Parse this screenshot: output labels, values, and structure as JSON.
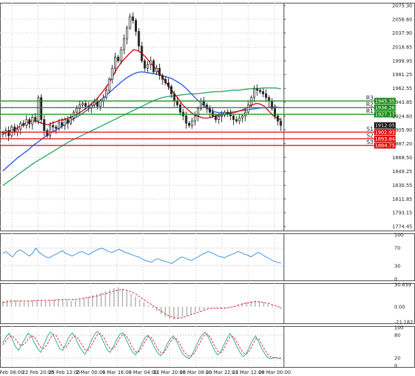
{
  "chart_data": {
    "type": "candlestick",
    "main": {
      "price_ticks": [
        "2075.30",
        "2056.60",
        "2037.90",
        "2018.65",
        "1999.95",
        "1981.25",
        "1962.55",
        "1943.85",
        "1924.60",
        "1905.90",
        "1887.20",
        "1868.50",
        "1849.25",
        "1830.55",
        "1811.85",
        "1793.15",
        "1774.45"
      ],
      "ylim": [
        1774.45,
        2075.3
      ],
      "current_price": "1912.05",
      "levels": [
        {
          "label": "R3",
          "value": 1945.35,
          "tag": "1945.35",
          "color": "#1a8c1a"
        },
        {
          "label": "R2",
          "value": 1936.26,
          "tag": "1936.26",
          "color": "#1a8c1a"
        },
        {
          "label": "R1",
          "value": 1927.17,
          "tag": "1927.17",
          "color": "#1a8c1a"
        },
        {
          "label": "S1",
          "value": 1902.93,
          "tag": "1902.93",
          "color": "#e01010"
        },
        {
          "label": "S2",
          "value": 1893.84,
          "tag": "1893.84",
          "color": "#e01010"
        },
        {
          "label": "S3",
          "value": 1884.75,
          "tag": "1884.75",
          "color": "#e01010"
        }
      ],
      "close_series": [
        1902,
        1905,
        1898,
        1910,
        1903,
        1907,
        1915,
        1912,
        1920,
        1914,
        1923,
        1918,
        1950,
        1920,
        1905,
        1898,
        1912,
        1910,
        1908,
        1916,
        1912,
        1920,
        1915,
        1922,
        1930,
        1935,
        1940,
        1942,
        1938,
        1936,
        1940,
        1944,
        1938,
        1945,
        1950,
        1960,
        1975,
        1990,
        2005,
        2000,
        2015,
        2030,
        2045,
        2060,
        2055,
        2040,
        2020,
        2000,
        1990,
        1995,
        2000,
        1985,
        1990,
        1980,
        1975,
        1970,
        1965,
        1955,
        1945,
        1940,
        1930,
        1925,
        1915,
        1912,
        1918,
        1925,
        1935,
        1945,
        1940,
        1935,
        1930,
        1925,
        1920,
        1924,
        1926,
        1930,
        1928,
        1925,
        1920,
        1918,
        1922,
        1925,
        1930,
        1940,
        1950,
        1962,
        1960,
        1958,
        1955,
        1950,
        1945,
        1935,
        1925,
        1918,
        1912
      ],
      "sma_red": [
        1900,
        1903,
        1905,
        1907,
        1910,
        1913,
        1916,
        1918,
        1918,
        1916,
        1914,
        1913,
        1915,
        1917,
        1919,
        1920,
        1922,
        1924,
        1927,
        1930,
        1934,
        1938,
        1943,
        1948,
        1955,
        1962,
        1970,
        1980,
        1990,
        1998,
        2004,
        2010,
        2015,
        2014,
        2010,
        2005,
        1998,
        1992,
        1985,
        1978,
        1970,
        1962,
        1955,
        1948,
        1940,
        1935,
        1930,
        1926,
        1924,
        1922,
        1922,
        1923,
        1925,
        1926,
        1927,
        1928,
        1929,
        1930,
        1932,
        1934,
        1937,
        1940,
        1942,
        1941,
        1938,
        1932,
        1926,
        1922,
        1920
      ],
      "sma_blue": [
        1850,
        1856,
        1862,
        1868,
        1873,
        1878,
        1884,
        1889,
        1894,
        1899,
        1903,
        1907,
        1911,
        1916,
        1920,
        1924,
        1928,
        1933,
        1938,
        1943,
        1948,
        1954,
        1960,
        1966,
        1972,
        1977,
        1981,
        1984,
        1985,
        1984,
        1983,
        1982,
        1980,
        1978,
        1976,
        1972,
        1968,
        1962,
        1955,
        1948,
        1942,
        1936,
        1932,
        1930,
        1929,
        1929,
        1930,
        1931,
        1932,
        1933,
        1934,
        1935,
        1936,
        1936,
        1937,
        1937,
        1936
      ],
      "sma_green": [
        1830,
        1836,
        1842,
        1848,
        1854,
        1860,
        1865,
        1870,
        1875,
        1880,
        1885,
        1890,
        1894,
        1898,
        1902,
        1906,
        1910,
        1914,
        1918,
        1922,
        1926,
        1930,
        1934,
        1938,
        1942,
        1946,
        1949,
        1951,
        1952,
        1953,
        1954,
        1955,
        1955,
        1956,
        1957,
        1958,
        1958,
        1959,
        1960,
        1960,
        1961,
        1962,
        1962,
        1963,
        1963,
        1963,
        1962
      ]
    },
    "x_tick_labels": [
      "Feb 08:00",
      "22 Feb 20:00",
      "25 Feb 12:00",
      "2 Mar 00:00",
      "4 Mar 16:00",
      "9 Mar 04:00",
      "11 Mar 20:00",
      "16 Mar 08:00",
      "20 Mar 22:01",
      "23 Mar 12:00",
      "28 Mar 00:00"
    ],
    "rsi": {
      "ticks": [
        "100",
        "70",
        "30",
        "0"
      ],
      "ylim": [
        0,
        100
      ],
      "values": [
        58,
        62,
        55,
        50,
        60,
        66,
        63,
        57,
        52,
        58,
        70,
        60,
        55,
        50,
        48,
        52,
        56,
        60,
        64,
        58,
        55,
        52,
        56,
        60,
        62,
        58,
        55,
        60,
        64,
        68,
        70,
        66,
        62,
        60,
        63,
        67,
        64,
        60,
        58,
        55,
        52,
        50,
        46,
        42,
        40,
        38,
        44,
        46,
        42,
        40,
        38,
        35,
        40,
        45,
        50,
        48,
        44,
        42,
        46,
        50,
        55,
        58,
        62,
        60,
        56,
        52,
        50,
        48,
        52,
        55,
        58,
        62,
        60,
        56,
        54,
        50,
        55,
        60,
        58,
        52,
        48,
        44,
        40,
        38,
        36
      ]
    },
    "macd": {
      "ticks": [
        "30.839",
        "0.00",
        "-21.182"
      ],
      "ylim": [
        -21.182,
        30.839
      ],
      "histogram": [
        8,
        9,
        10,
        9,
        8,
        7,
        8,
        9,
        10,
        9,
        8,
        9,
        10,
        11,
        10,
        9,
        8,
        9,
        10,
        12,
        14,
        16,
        18,
        20,
        22,
        24,
        26,
        27,
        25,
        22,
        18,
        14,
        10,
        6,
        2,
        -2,
        -6,
        -10,
        -14,
        -17,
        -18,
        -16,
        -14,
        -12,
        -10,
        -8,
        -6,
        -4,
        -2,
        -1,
        -2,
        -3,
        -2,
        -1,
        1,
        3,
        5,
        7,
        8,
        9,
        8,
        6,
        4,
        2,
        -1,
        -3
      ],
      "signal": [
        6,
        7,
        8,
        8,
        8,
        8,
        8,
        8,
        9,
        9,
        9,
        9,
        9,
        10,
        10,
        10,
        10,
        10,
        11,
        12,
        13,
        14,
        15,
        17,
        18,
        20,
        22,
        23,
        24,
        23,
        21,
        18,
        14,
        10,
        6,
        2,
        -2,
        -6,
        -10,
        -13,
        -15,
        -16,
        -15,
        -13,
        -11,
        -9,
        -7,
        -5,
        -3,
        -2,
        -2,
        -2,
        -2,
        -1,
        0,
        2,
        4,
        5,
        6,
        7,
        7,
        6,
        5,
        3,
        1,
        -1
      ]
    },
    "stochastic": {
      "ticks": [
        "100",
        "80",
        "20",
        "0"
      ],
      "ylim": [
        0,
        100
      ],
      "k": [
        60,
        75,
        85,
        70,
        50,
        40,
        55,
        70,
        85,
        78,
        60,
        45,
        35,
        55,
        75,
        88,
        80,
        62,
        45,
        40,
        58,
        76,
        86,
        72,
        55,
        40,
        30,
        45,
        65,
        82,
        90,
        78,
        60,
        42,
        35,
        50,
        68,
        82,
        86,
        70,
        52,
        36,
        28,
        40,
        58,
        74,
        80,
        66,
        48,
        34,
        26,
        38,
        56,
        70,
        78,
        64,
        46,
        30,
        22,
        18,
        30,
        48,
        66,
        80,
        88,
        76,
        58,
        40,
        28,
        36,
        55,
        72,
        84,
        70,
        52,
        36,
        24,
        30,
        48,
        66,
        78,
        62,
        44,
        30,
        20,
        18,
        22,
        20,
        18
      ],
      "d": [
        55,
        65,
        75,
        78,
        70,
        58,
        52,
        58,
        70,
        78,
        76,
        62,
        48,
        45,
        55,
        72,
        82,
        78,
        62,
        48,
        48,
        60,
        74,
        78,
        70,
        55,
        42,
        40,
        52,
        68,
        82,
        84,
        74,
        56,
        44,
        44,
        56,
        72,
        82,
        80,
        66,
        48,
        36,
        36,
        48,
        64,
        76,
        74,
        60,
        44,
        34,
        34,
        46,
        62,
        72,
        70,
        58,
        42,
        30,
        24,
        26,
        38,
        54,
        70,
        82,
        82,
        70,
        52,
        38,
        34,
        44,
        62,
        76,
        76,
        64,
        48,
        34,
        30,
        38,
        54,
        70,
        70,
        56,
        40,
        28,
        22,
        20,
        20,
        20
      ]
    }
  }
}
